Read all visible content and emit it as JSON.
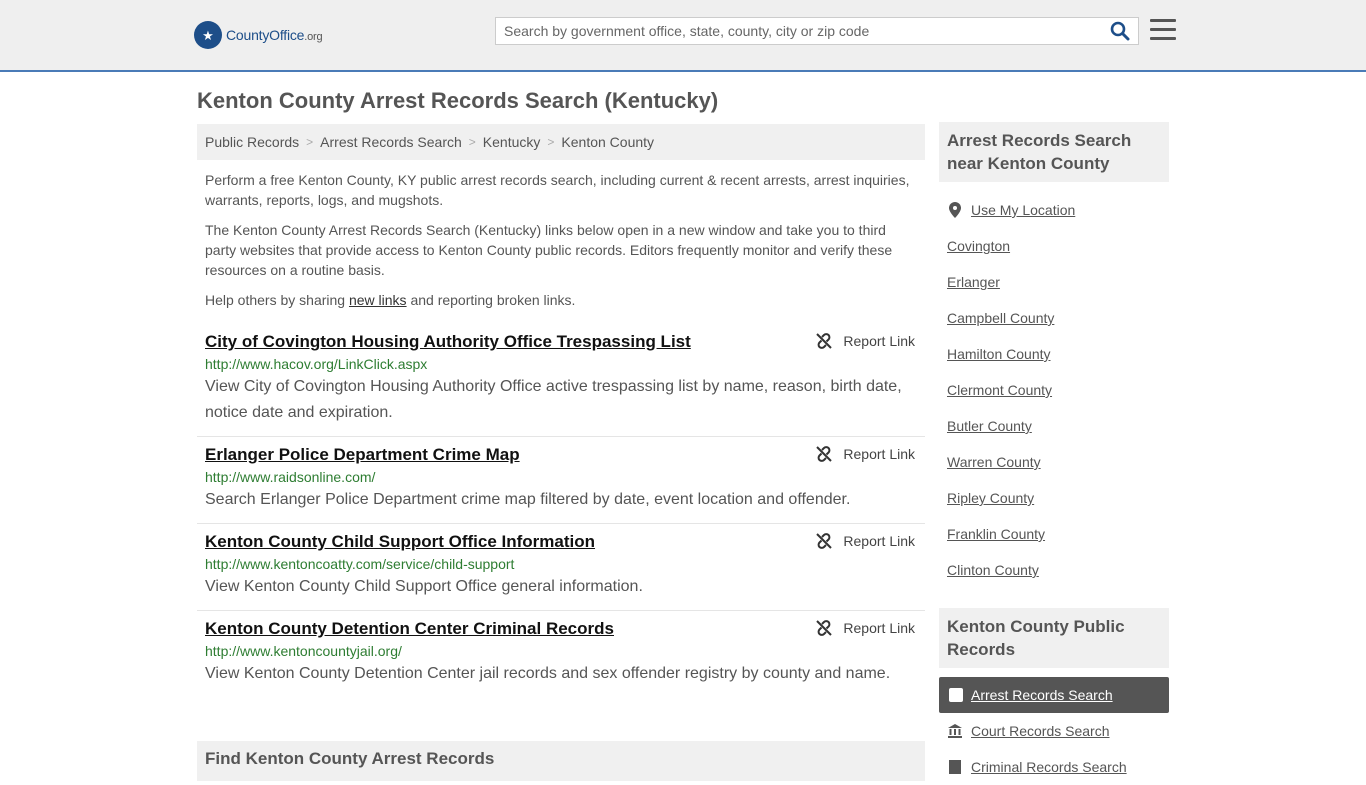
{
  "header": {
    "logo_main": "CountyOffice",
    "logo_tld": ".org",
    "search_placeholder": "Search by government office, state, county, city or zip code"
  },
  "page": {
    "title": "Kenton County Arrest Records Search (Kentucky)"
  },
  "breadcrumb": [
    "Public Records",
    "Arrest Records Search",
    "Kentucky",
    "Kenton County"
  ],
  "intro": {
    "p1": "Perform a free Kenton County, KY public arrest records search, including current & recent arrests, arrest inquiries, warrants, reports, logs, and mugshots.",
    "p2": "The Kenton County Arrest Records Search (Kentucky) links below open in a new window and take you to third party websites that provide access to Kenton County public records. Editors frequently monitor and verify these resources on a routine basis.",
    "p3_before": "Help others by sharing ",
    "p3_link": "new links",
    "p3_after": " and reporting broken links."
  },
  "report_label": "Report Link",
  "links": [
    {
      "title": "City of Covington Housing Authority Office Trespassing List",
      "url": "http://www.hacov.org/LinkClick.aspx",
      "desc": "View City of Covington Housing Authority Office active trespassing list by name, reason, birth date, notice date and expiration."
    },
    {
      "title": "Erlanger Police Department Crime Map",
      "url": "http://www.raidsonline.com/",
      "desc": "Search Erlanger Police Department crime map filtered by date, event location and offender."
    },
    {
      "title": "Kenton County Child Support Office Information",
      "url": "http://www.kentoncoatty.com/service/child-support",
      "desc": "View Kenton County Child Support Office general information."
    },
    {
      "title": "Kenton County Detention Center Criminal Records",
      "url": "http://www.kentoncountyjail.org/",
      "desc": "View Kenton County Detention Center jail records and sex offender registry by county and name."
    }
  ],
  "find_heading": "Find Kenton County Arrest Records",
  "sidebar": {
    "nearby_heading": "Arrest Records Search near Kenton County",
    "use_location": "Use My Location",
    "nearby": [
      "Covington",
      "Erlanger",
      "Campbell County",
      "Hamilton County",
      "Clermont County",
      "Butler County",
      "Warren County",
      "Ripley County",
      "Franklin County",
      "Clinton County"
    ],
    "records_heading": "Kenton County Public Records",
    "records_active": "Arrest Records Search",
    "records": [
      "Court Records Search",
      "Criminal Records Search"
    ]
  },
  "colors": {
    "header_border": "#4a7bb7",
    "brand": "#1d4e89",
    "url_green": "#2e7d32",
    "active_bg": "#555555"
  }
}
